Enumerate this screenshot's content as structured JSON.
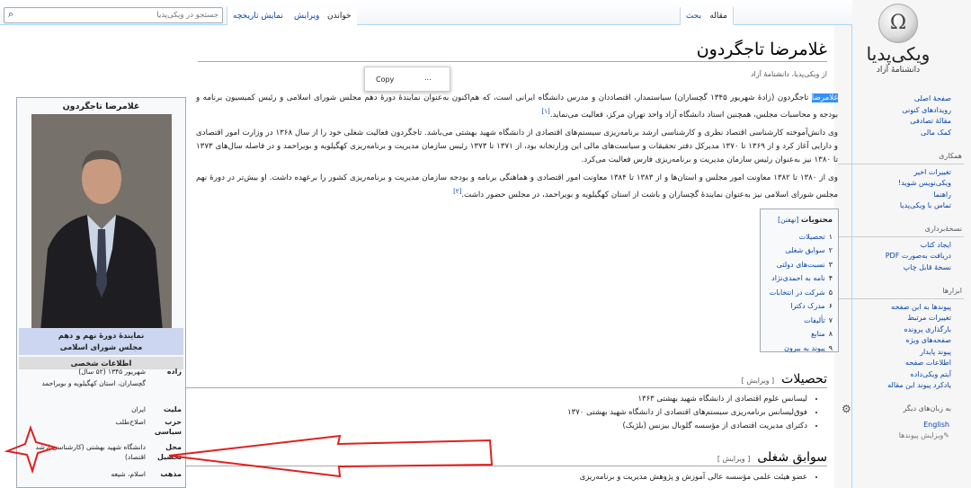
{
  "logo": {
    "glyph": "Ω",
    "name": "ویکی‌پدیا",
    "tagline": "دانشنامهٔ آزاد"
  },
  "nav_main": [
    "صفحهٔ اصلی",
    "رویدادهای کنونی",
    "مقالهٔ تصادفی",
    "کمک مالی"
  ],
  "nav_interact": {
    "title": "همکاری",
    "items": [
      "تغییرات اخیر",
      "ویکی‌نویس شوید!",
      "راهنما",
      "تماس با ویکی‌پدیا"
    ]
  },
  "nav_print": {
    "title": "نسخهٔ‌برداری",
    "items": [
      "ایجاد کتاب",
      "دریافت به‌صورت PDF",
      "نسخهٔ قابل چاپ"
    ]
  },
  "nav_tools": {
    "title": "ابزارها",
    "items": [
      "پیوندها به این صفحه",
      "تغییرات مرتبط",
      "بارگذاری پرونده",
      "صفحه‌های ویژه",
      "پیوند پایدار",
      "اطلاعات صفحه",
      "آیتم ویکی‌داده",
      "یادکرد پیوند این مقاله"
    ]
  },
  "languages": {
    "title": "به زبان‌های دیگر",
    "english": "English",
    "edit": "✎ویرایش پیوندها"
  },
  "tabs": {
    "article": "مقاله",
    "talk": "بحث",
    "read": "خواندن",
    "edit": "ویرایش",
    "history": "نمایش تاریخچه"
  },
  "search": {
    "placeholder": "جستجو در ویکی‌پدیا"
  },
  "title": "غلامرضا تاجگردون",
  "from": "از ویکی‌پدیا، دانشنامهٔ آزاد",
  "popup": {
    "copy": "Copy",
    "more": "..."
  },
  "lead": {
    "hl": "غلامرضا",
    "p1a": " تاجگردون (زادهٔ شهریور ۱۳۴۵ گچساران) سیاستمدار، اقتصاددان و مدرس دانشگاه ایرانی است، که هم‌اکنون به‌عنوان نمایندهٔ دورهٔ دهم مجلس شورای اسلامی و رئیس کمیسیون برنامه و بودجه و محاسبات مجلس، همچنین استاد دانشگاه آزاد واحد تهران مرکز، فعالیت می‌نماید.",
    "ref1": "[۱]",
    "p2": "وی دانش‌آموخته کارشناسی اقتصاد نظری و کارشناسی ارشد برنامه‌ریزی سیستم‌های اقتصادی از دانشگاه شهید بهشتی می‌باشد. تاجگردون فعالیت شغلی خود را از سال ۱۳۶۸ در وزارت امور اقتصادی و دارایی آغاز کرد و از ۱۳۶۹ تا ۱۳۷۰ مدیرکل دفتر تحقیقات و سیاست‌های مالی این وزارتخانه بود، از ۱۳۷۱ تا ۱۳۷۳ رئیس سازمان مدیریت و برنامه‌ریزی کهگیلویه و بویراحمد و در فاصله سال‌های ۱۳۷۳ تا ۱۳۸۰ نیز به‌عنوان رئیس سازمان مدیریت و برنامه‌ریزی فارس فعالیت می‌کرد.",
    "p3": "وی از ۱۳۸۰ تا ۱۳۸۲ معاونت امور مجلس و استان‌ها و از ۱۳۸۳ تا ۱۳۸۴ معاونت امور اقتصادی و هماهنگی برنامه و بودجه سازمان مدیریت و برنامه‌ریزی کشور را برعهده داشت. او بیش‌تر در دورهٔ نهم مجلس شورای اسلامی نیز به‌عنوان نمایندهٔ گچساران و باشت از استان کهگیلویه و بویراحمد، در مجلس حضور داشت.",
    "ref2": "[۲]"
  },
  "toc": {
    "title": "محتویات",
    "hide": "[نهفتن]",
    "items": [
      {
        "n": "۱",
        "t": "تحصیلات"
      },
      {
        "n": "۲",
        "t": "سوابق شغلی"
      },
      {
        "n": "۳",
        "t": "نسبت‌های دولتی"
      },
      {
        "n": "۴",
        "t": "نامه به احمدی‌نژاد"
      },
      {
        "n": "۵",
        "t": "شرکت در انتخابات"
      },
      {
        "n": "۶",
        "t": "مدرک دکترا"
      },
      {
        "n": "۷",
        "t": "تألیفات"
      },
      {
        "n": "۸",
        "t": "منابع"
      },
      {
        "n": "۹",
        "t": "پیوند به بیرون"
      }
    ]
  },
  "sec_edu": {
    "title": "تحصیلات",
    "edit": "[ ویرایش ]",
    "items": [
      "لیسانس علوم اقتصادی از دانشگاه شهید بهشتی ۱۳۶۳",
      "فوق‌لیسانس برنامه‌ریزی سیستم‌های اقتصادی از دانشگاه شهید بهشتی ۱۳۷۰",
      "دکترای مدیریت اقتصادی از مؤسسه گلوبال بیزنس (بلژیک)"
    ]
  },
  "sec_career": {
    "title": "سوابق شغلی",
    "edit": "[ ویرایش ]",
    "items": [
      "عضو هیئت علمی مؤسسه عالی آموزش و پژوهش مدیریت و برنامه‌ریزی"
    ]
  },
  "infobox": {
    "title": "غلامرضا تاجگردون",
    "office1": "نمایندهٔ دورهٔ نهم و دهم",
    "office2": "مجلس شورای اسلامی",
    "personal": "اطلاعات شخصی",
    "rows": [
      {
        "k": "زاده",
        "v": "شهریور ۱۳۴۵ (۵۲ سال)"
      },
      {
        "k": "",
        "v": "گچساران، استان کهگیلویه و بویراحمد"
      },
      {
        "k": "ملیت",
        "v": "ایران"
      },
      {
        "k": "حزب سیاسی",
        "v": "اصلاح‌طلب"
      },
      {
        "k": "محل تحصیل",
        "v": "دانشگاه شهید بهشتی (کارشناسی ارشد اقتصاد)"
      },
      {
        "k": "مذهب",
        "v": "اسلام، شیعه"
      }
    ]
  },
  "colors": {
    "link": "#0645ad",
    "highlight": "#3390ff",
    "annotation": "#e02020",
    "office_band": "#ccd6f0"
  }
}
